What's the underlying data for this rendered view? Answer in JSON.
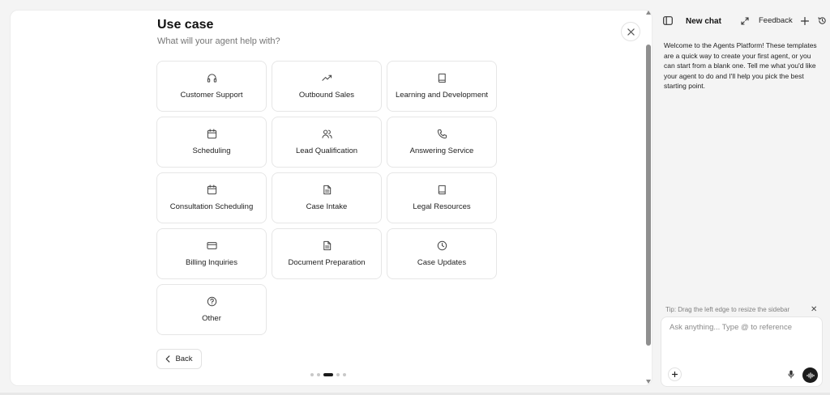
{
  "modal": {
    "title": "Use case",
    "subtitle": "What will your agent help with?",
    "back_label": "Back",
    "steps": {
      "total": 5,
      "current": 3
    }
  },
  "use_cases": [
    {
      "label": "Customer Support",
      "icon": "headphones-icon"
    },
    {
      "label": "Outbound Sales",
      "icon": "trending-up-icon"
    },
    {
      "label": "Learning and Development",
      "icon": "book-icon"
    },
    {
      "label": "Scheduling",
      "icon": "calendar-icon"
    },
    {
      "label": "Lead Qualification",
      "icon": "users-icon"
    },
    {
      "label": "Answering Service",
      "icon": "phone-icon"
    },
    {
      "label": "Consultation Scheduling",
      "icon": "calendar-icon"
    },
    {
      "label": "Case Intake",
      "icon": "document-icon"
    },
    {
      "label": "Legal Resources",
      "icon": "book-icon"
    },
    {
      "label": "Billing Inquiries",
      "icon": "credit-card-icon"
    },
    {
      "label": "Document Preparation",
      "icon": "document-icon"
    },
    {
      "label": "Case Updates",
      "icon": "clock-icon"
    },
    {
      "label": "Other",
      "icon": "help-circle-icon"
    }
  ],
  "sidebar": {
    "title": "New chat",
    "feedback_label": "Feedback",
    "welcome": "Welcome to the Agents Platform! These templates are a quick way to create your first agent, or you can start from a blank one. Tell me what you'd like your agent to do and I'll help you pick the best starting point.",
    "tip": "Tip: Drag the left edge to resize the sidebar",
    "input_placeholder": "Ask anything... Type @ to reference"
  },
  "colors": {
    "accent": "#1a1a1a",
    "border": "#e6e6e6",
    "muted_text": "#767676"
  }
}
